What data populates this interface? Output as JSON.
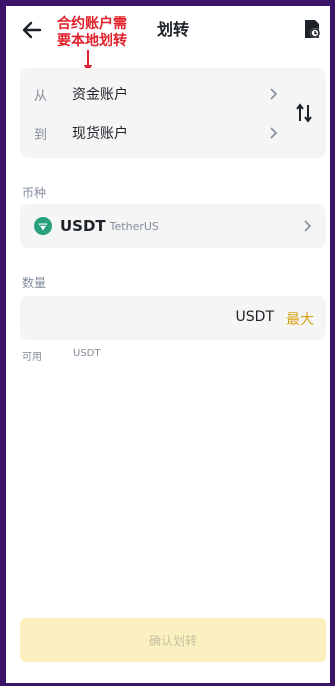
{
  "header": {
    "title": "划转"
  },
  "annotation": {
    "line1": "合约账户需",
    "line2": "要本地划转",
    "color": "#e0202a"
  },
  "transfer": {
    "from_label": "从",
    "from_account": "资金账户",
    "to_label": "到",
    "to_account": "现货账户"
  },
  "coin": {
    "section_label": "币种",
    "symbol": "USDT",
    "name": "TetherUS",
    "icon": "tether-icon"
  },
  "quantity": {
    "section_label": "数量",
    "value": "",
    "unit": "USDT",
    "max_label": "最大"
  },
  "available": {
    "label": "可用",
    "unit": "USDT"
  },
  "confirm_label": "确认划转",
  "colors": {
    "accent": "#d8a415",
    "confirm_bg": "#fbf0c0",
    "frame": "#3a1268"
  }
}
